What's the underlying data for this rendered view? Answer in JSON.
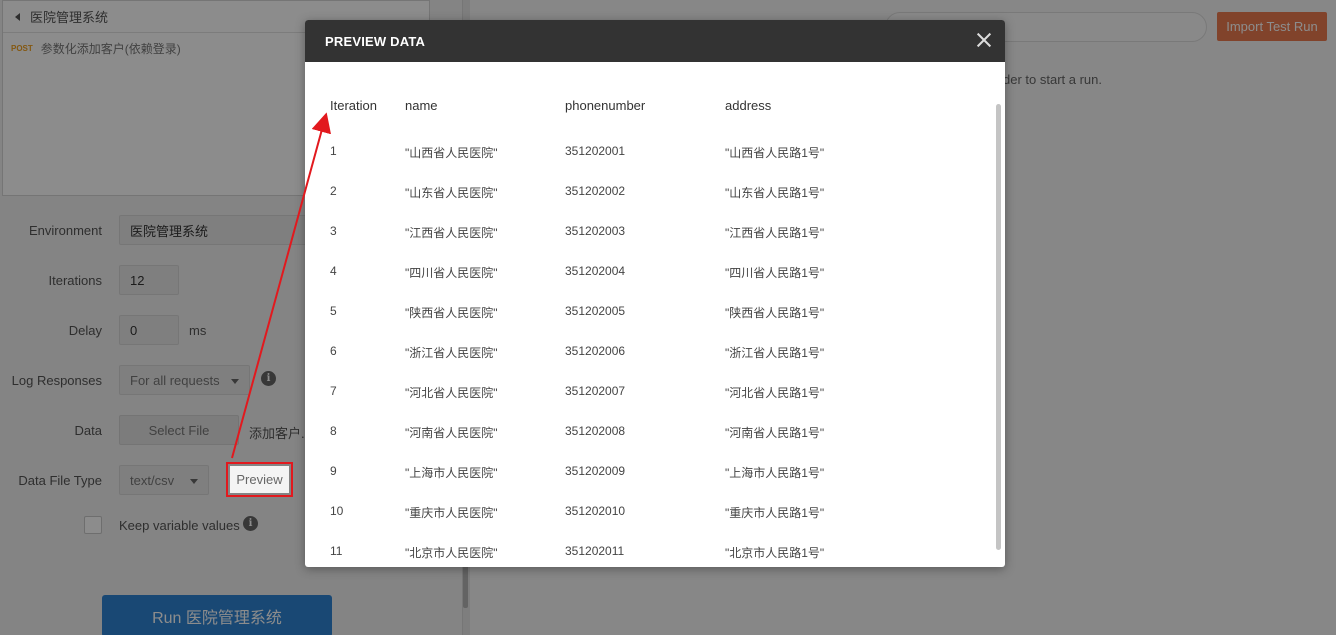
{
  "left": {
    "collection_name": "医院管理系统",
    "request_method": "POST",
    "request_name": "参数化添加客户(依赖登录)",
    "environment_label": "Environment",
    "environment_value": "医院管理系统",
    "iterations_label": "Iterations",
    "iterations_value": "12",
    "delay_label": "Delay",
    "delay_value": "0",
    "delay_unit": "ms",
    "log_label": "Log Responses",
    "log_value": "For all requests",
    "data_label": "Data",
    "select_file_label": "Select File",
    "data_file_name": "添加客户.c",
    "file_type_label": "Data File Type",
    "file_type_value": "text/csv",
    "preview_label": "Preview",
    "keep_vars_label": "Keep variable values",
    "run_label": "Run 医院管理系统"
  },
  "right": {
    "import_label": "Import Test Run",
    "hint_text": "der to start a run."
  },
  "modal": {
    "title": "PREVIEW DATA",
    "headers": [
      "Iteration",
      "name",
      "phonenumber",
      "address"
    ],
    "rows": [
      [
        "1",
        "\"山西省人民医院\"",
        "351202001",
        "\"山西省人民路1号\""
      ],
      [
        "2",
        "\"山东省人民医院\"",
        "351202002",
        "\"山东省人民路1号\""
      ],
      [
        "3",
        "\"江西省人民医院\"",
        "351202003",
        "\"江西省人民路1号\""
      ],
      [
        "4",
        "\"四川省人民医院\"",
        "351202004",
        "\"四川省人民路1号\""
      ],
      [
        "5",
        "\"陕西省人民医院\"",
        "351202005",
        "\"陕西省人民路1号\""
      ],
      [
        "6",
        "\"浙江省人民医院\"",
        "351202006",
        "\"浙江省人民路1号\""
      ],
      [
        "7",
        "\"河北省人民医院\"",
        "351202007",
        "\"河北省人民路1号\""
      ],
      [
        "8",
        "\"河南省人民医院\"",
        "351202008",
        "\"河南省人民路1号\""
      ],
      [
        "9",
        "\"上海市人民医院\"",
        "351202009",
        "\"上海市人民路1号\""
      ],
      [
        "10",
        "\"重庆市人民医院\"",
        "351202010",
        "\"重庆市人民路1号\""
      ],
      [
        "11",
        "\"北京市人民医院\"",
        "351202011",
        "\"北京市人民路1号\""
      ]
    ]
  },
  "colors": {
    "run_button": "#2e83d4",
    "import_button": "#ec7a4f",
    "modal_header": "#333333",
    "annotation_red": "#e2191e"
  }
}
